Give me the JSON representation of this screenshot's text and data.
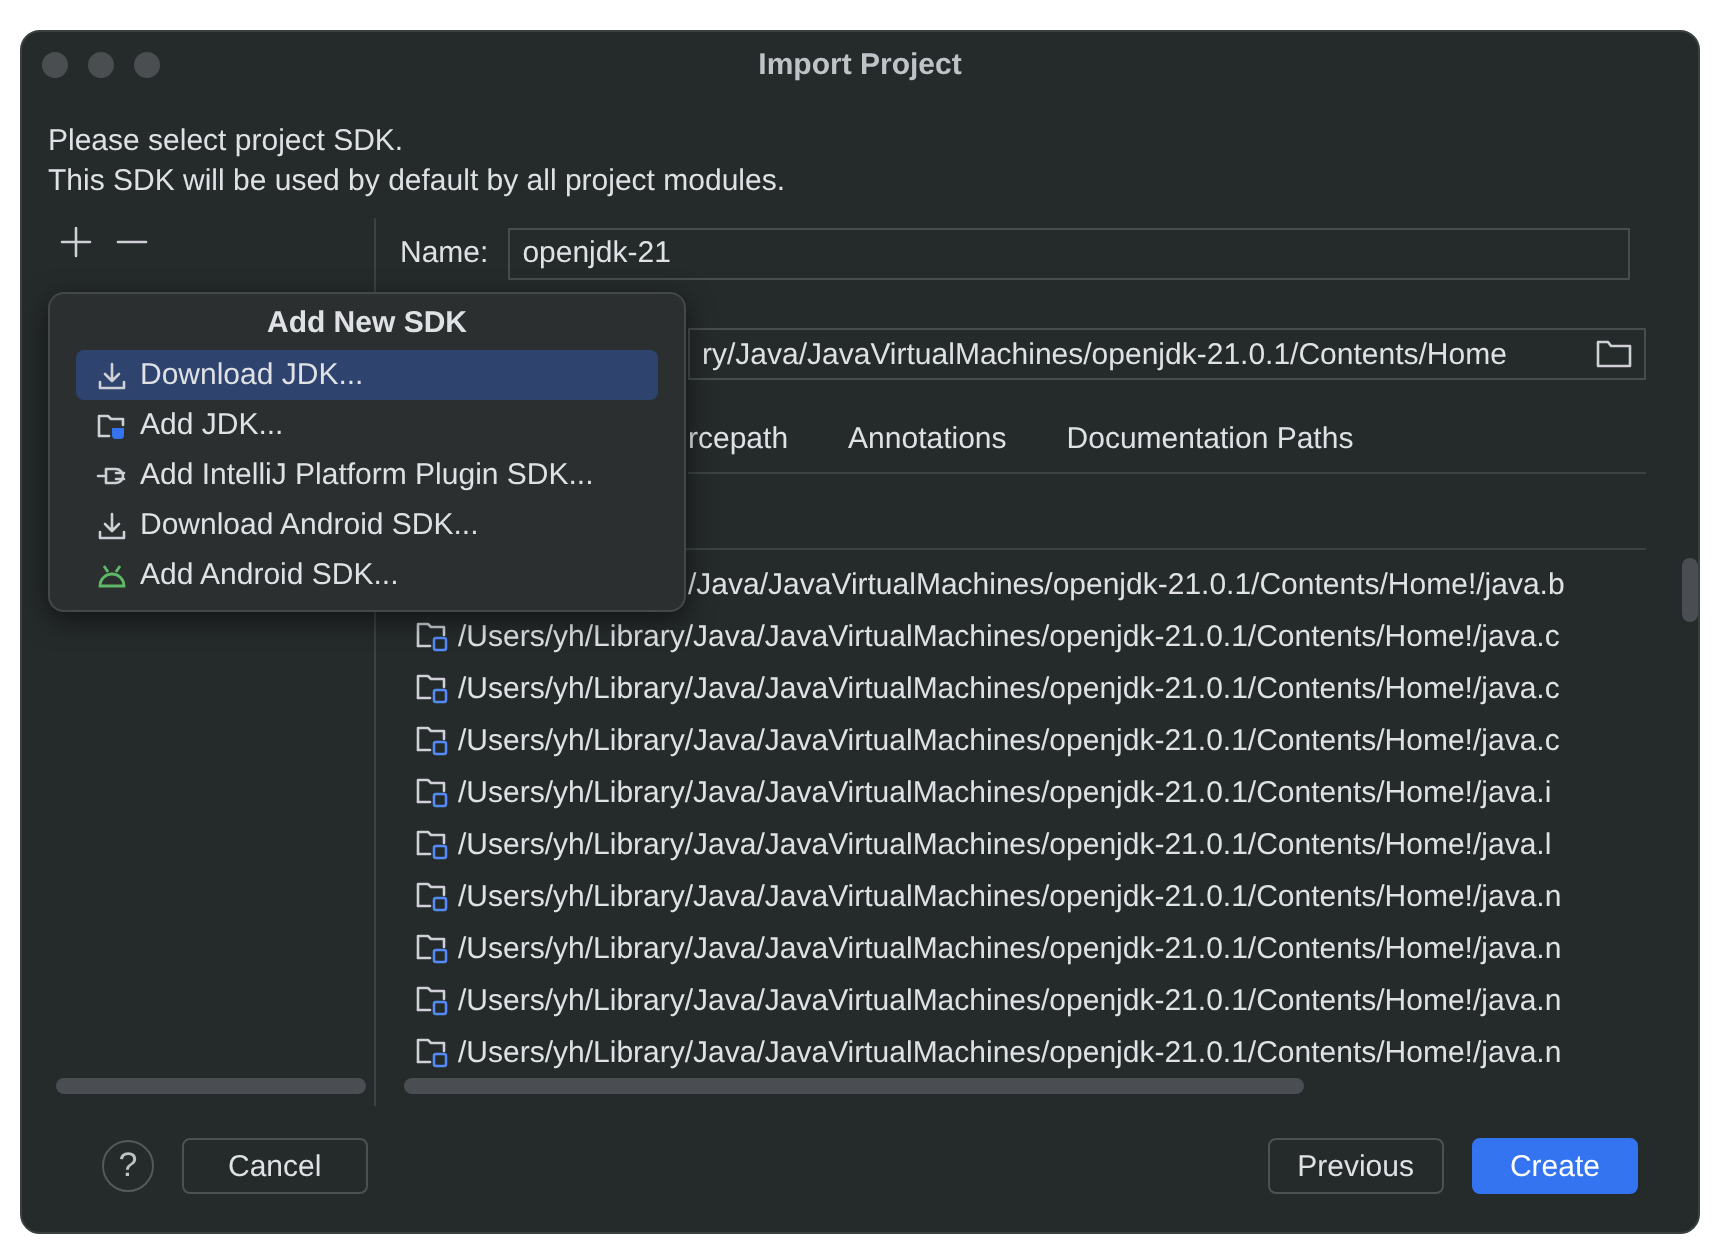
{
  "window": {
    "title": "Import Project"
  },
  "intro": [
    "Please select project SDK.",
    "This SDK will be used by default by all project modules."
  ],
  "name_field": {
    "label": "Name:",
    "value": "openjdk-21"
  },
  "home_field": {
    "value": "ry/Java/JavaVirtualMachines/openjdk-21.0.1/Contents/Home"
  },
  "tabs": [
    {
      "label": "rcepath",
      "selected": false
    },
    {
      "label": "Annotations",
      "selected": false
    },
    {
      "label": "Documentation Paths",
      "selected": false
    }
  ],
  "paths": [
    {
      "text": "/Java/JavaVirtualMachines/openjdk-21.0.1/Contents/Home!/java.b",
      "covered": true
    },
    {
      "text": "/Users/yh/Library/Java/JavaVirtualMachines/openjdk-21.0.1/Contents/Home!/java.c",
      "covered": false
    },
    {
      "text": "/Users/yh/Library/Java/JavaVirtualMachines/openjdk-21.0.1/Contents/Home!/java.c",
      "covered": false
    },
    {
      "text": "/Users/yh/Library/Java/JavaVirtualMachines/openjdk-21.0.1/Contents/Home!/java.c",
      "covered": false
    },
    {
      "text": "/Users/yh/Library/Java/JavaVirtualMachines/openjdk-21.0.1/Contents/Home!/java.i",
      "covered": false
    },
    {
      "text": "/Users/yh/Library/Java/JavaVirtualMachines/openjdk-21.0.1/Contents/Home!/java.l",
      "covered": false
    },
    {
      "text": "/Users/yh/Library/Java/JavaVirtualMachines/openjdk-21.0.1/Contents/Home!/java.n",
      "covered": false
    },
    {
      "text": "/Users/yh/Library/Java/JavaVirtualMachines/openjdk-21.0.1/Contents/Home!/java.n",
      "covered": false
    },
    {
      "text": "/Users/yh/Library/Java/JavaVirtualMachines/openjdk-21.0.1/Contents/Home!/java.n",
      "covered": false
    },
    {
      "text": "/Users/yh/Library/Java/JavaVirtualMachines/openjdk-21.0.1/Contents/Home!/java.n",
      "covered": false
    }
  ],
  "popup": {
    "title": "Add New SDK",
    "items": [
      {
        "label": "Download JDK...",
        "kind": "download",
        "selected": true
      },
      {
        "label": "Add JDK...",
        "kind": "folder",
        "selected": false
      },
      {
        "label": "Add IntelliJ Platform Plugin SDK...",
        "kind": "plug",
        "selected": false
      },
      {
        "label": "Download Android SDK...",
        "kind": "download",
        "selected": false
      },
      {
        "label": "Add Android SDK...",
        "kind": "android",
        "selected": false
      }
    ]
  },
  "help": "?",
  "buttons": [
    {
      "label": "Cancel",
      "kind": "secondary"
    },
    {
      "label": "Previous",
      "kind": "secondary"
    },
    {
      "label": "Create",
      "kind": "primary"
    }
  ]
}
